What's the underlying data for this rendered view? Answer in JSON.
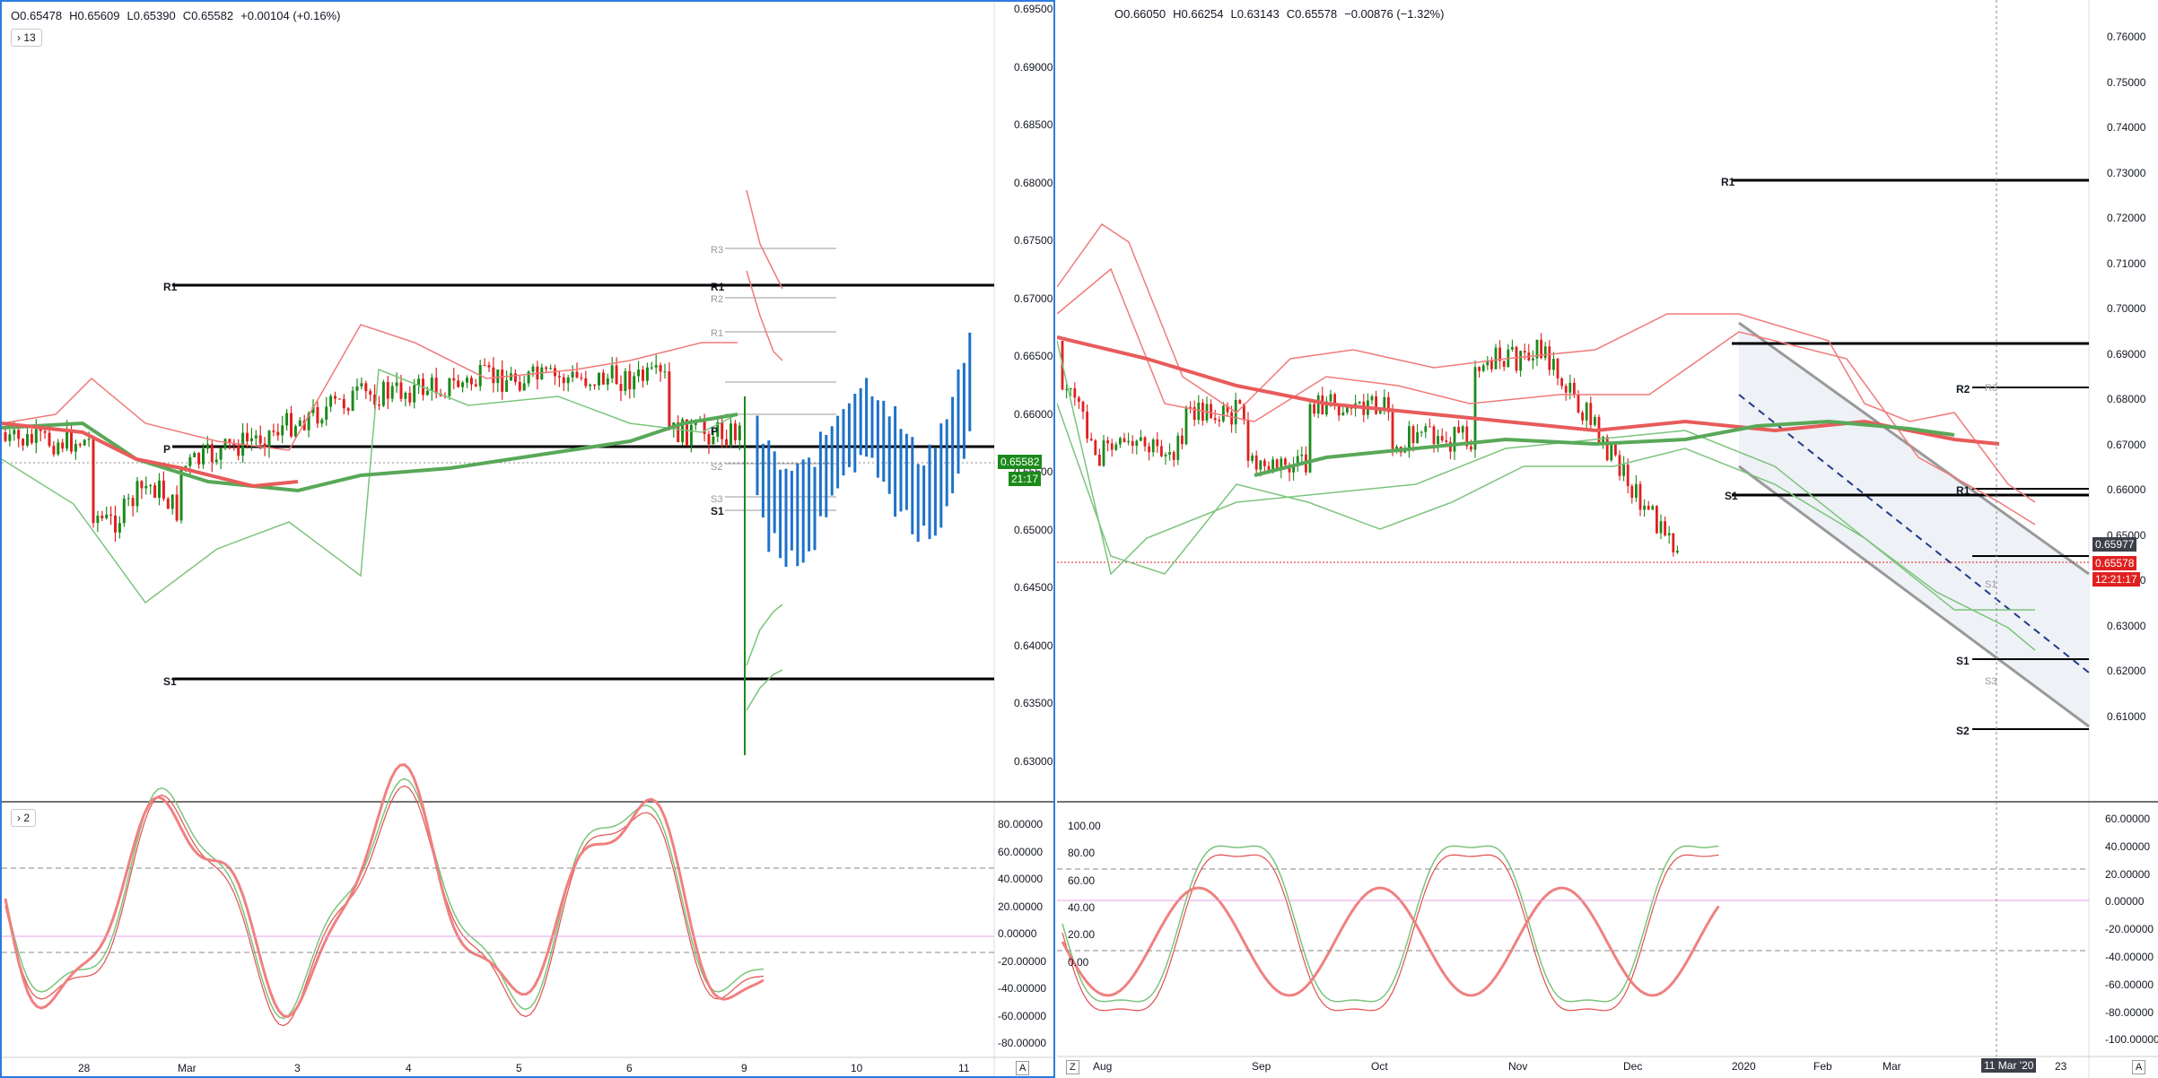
{
  "left_chart": {
    "ohlc": {
      "open": "O0.65478",
      "high": "H0.65609",
      "low": "L0.65390",
      "close": "C0.65582",
      "change": "+0.00104 (+0.16%)"
    },
    "indicator_toggle": "13",
    "price_ticks": [
      "0.69500",
      "0.69000",
      "0.68500",
      "0.68000",
      "0.67500",
      "0.67000",
      "0.66500",
      "0.66000",
      "0.65500",
      "0.65000",
      "0.64500",
      "0.64000",
      "0.63500",
      "0.63000"
    ],
    "price_tag": "0.65582",
    "countdown": "21:17",
    "osc_toggle": "2",
    "osc_ticks": [
      "80.00000",
      "60.00000",
      "40.00000",
      "20.00000",
      "0.00000",
      "-20.00000",
      "-40.00000",
      "-60.00000",
      "-80.00000"
    ],
    "time_ticks": [
      "28",
      "Mar",
      "3",
      "4",
      "5",
      "6",
      "9",
      "10",
      "11"
    ],
    "levels": {
      "r1": "R1",
      "p": "P",
      "s1": "S1",
      "r3": "R3",
      "r2": "R2",
      "r1b": "R1",
      "p2": "P",
      "s2": "S2",
      "s3": "S3",
      "s1b": "S1",
      "r1c": "R1"
    },
    "axis_button": "A"
  },
  "right_chart": {
    "ohlc": {
      "open": "O0.66050",
      "high": "H0.66254",
      "low": "L0.63143",
      "close": "C0.65578",
      "change": "−0.00876 (−1.32%)"
    },
    "price_ticks": [
      "0.76000",
      "0.75000",
      "0.74000",
      "0.73000",
      "0.72000",
      "0.71000",
      "0.70000",
      "0.69000",
      "0.68000",
      "0.67000",
      "0.66000",
      "0.65000",
      "0.64000",
      "0.63000",
      "0.62000",
      "0.61000"
    ],
    "price_tag_dark": "0.65977",
    "price_tag_red": "0.65578",
    "countdown": "12:21:17",
    "osc_left_ticks": [
      "100.00",
      "80.00",
      "60.00",
      "40.00",
      "20.00",
      "0.00"
    ],
    "osc_right_ticks": [
      "60.00000",
      "40.00000",
      "20.00000",
      "0.00000",
      "-20.00000",
      "-40.00000",
      "-60.00000",
      "-80.00000",
      "-100.00000"
    ],
    "time_ticks": [
      "Aug",
      "Sep",
      "Oct",
      "Nov",
      "Dec",
      "2020",
      "Feb",
      "Mar",
      "23"
    ],
    "date_badge": "11 Mar '20",
    "levels": {
      "r1": "R1",
      "r2": "R2",
      "r3": "R3",
      "r1b": "R1",
      "s1": "S1",
      "s1b": "S1",
      "s1c": "S1",
      "s2": "S2",
      "s3": "S3"
    },
    "axis_button_z": "Z",
    "axis_button_a": "A"
  },
  "colors": {
    "up": "#1b8a1b",
    "down": "#e02020",
    "band_red": "#f07a7a",
    "band_green": "#7cc47c",
    "ma_red": "#e85b5b",
    "ma_green": "#58a858",
    "blue": "#1e72c8",
    "accent": "#2d7be0"
  }
}
